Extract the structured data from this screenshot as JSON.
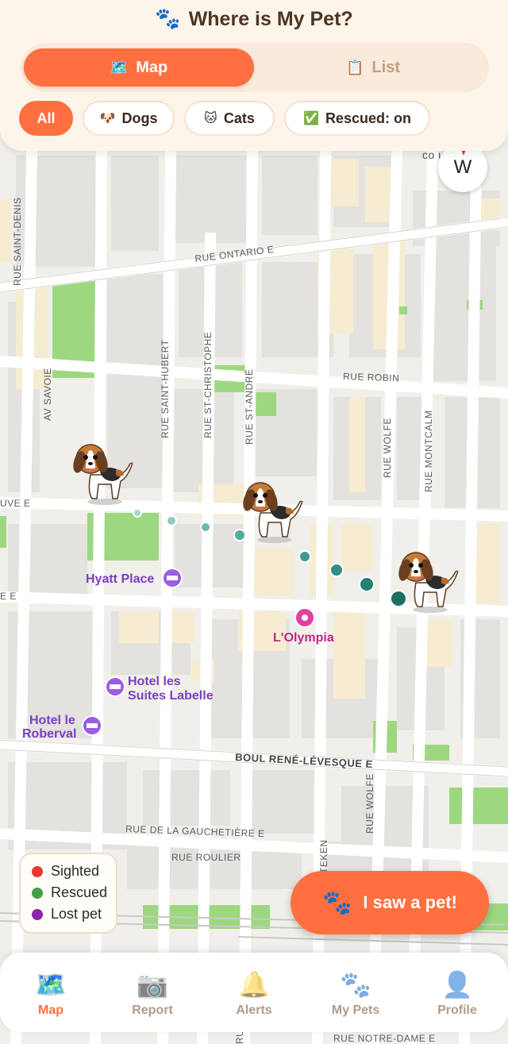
{
  "app": {
    "title": "Where is My Pet?",
    "title_icon": "paw-icon"
  },
  "view_toggle": {
    "map_label": "Map",
    "map_icon": "map-icon",
    "list_label": "List",
    "list_icon": "clipboard-icon",
    "selected": "map"
  },
  "filters": {
    "all": "All",
    "dogs": "Dogs",
    "dogs_icon": "dog-face-icon",
    "cats": "Cats",
    "cats_icon": "cat-face-icon",
    "rescued": "Rescued: on",
    "rescued_icon": "check-mark-icon",
    "selected": "all"
  },
  "map": {
    "compass_heading": "W",
    "streets": {
      "rue_ontario": "RUE ONTARIO E",
      "rue_robin": "RUE ROBIN",
      "rue_saint_denis": "RUE SAINT-DENIS",
      "av_savoie": "AV SAVOIE",
      "rue_saint_hubert": "RUE SAINT-HUBERT",
      "rue_st_christophe": "RUE ST-CHRISTOPHE",
      "rue_st_andre": "RUE ST-ANDRÉ",
      "rue_wolfe": "RUE WOLFE",
      "rue_montcalm": "RUE MONTCALM",
      "boul_rene_levesque": "BOUL RENÉ-LÉVESQUE E",
      "rue_gauchetiere": "RUE DE LA GAUCHETIÈRE E",
      "rue_roulier": "RUE ROULIER",
      "rue_wolfe_2": "RUE WOLFE",
      "ave_e": "UVE E",
      "e_left": "E E",
      "tekeny": "TEKEN",
      "notre_dame": "RUE NOTRE-DAME E",
      "rue_ore": "RUE ORE"
    },
    "pois": [
      {
        "name": "Hyatt Place",
        "icon": "bed-icon",
        "color": "#8e44d6"
      },
      {
        "name": "L'Olympia",
        "icon": "pin-icon",
        "color": "#d6339b"
      },
      {
        "name_line1": "Hotel les",
        "name_line2": "Suites Labelle",
        "icon": "bed-icon",
        "color": "#8e44d6"
      },
      {
        "name_line1": "Hotel le",
        "name_line2": "Roberval",
        "icon": "bed-icon",
        "color": "#8e44d6"
      }
    ],
    "markers": [
      {
        "kind": "dog",
        "icon": "beagle-icon"
      },
      {
        "kind": "dog",
        "icon": "beagle-icon"
      },
      {
        "kind": "dog",
        "icon": "beagle-icon"
      }
    ],
    "partial_label": "co  uta  d  -S"
  },
  "legend": {
    "items": [
      {
        "label": "Sighted",
        "color": "#e53935"
      },
      {
        "label": "Rescued",
        "color": "#43a047"
      },
      {
        "label": "Lost pet",
        "color": "#8e24aa"
      }
    ]
  },
  "fab": {
    "label": "I saw a pet!",
    "icon": "paw-icon"
  },
  "tabbar": {
    "tabs": [
      {
        "label": "Map",
        "icon": "map-icon",
        "active": true
      },
      {
        "label": "Report",
        "icon": "camera-icon",
        "active": false
      },
      {
        "label": "Alerts",
        "icon": "bell-icon",
        "active": false
      },
      {
        "label": "My Pets",
        "icon": "paw-prints-icon",
        "active": false
      },
      {
        "label": "Profile",
        "icon": "user-icon",
        "active": false
      }
    ]
  },
  "colors": {
    "accent": "#ff6f3f",
    "header_bg": "#fdf5ea",
    "track": "#2a8c7e"
  }
}
